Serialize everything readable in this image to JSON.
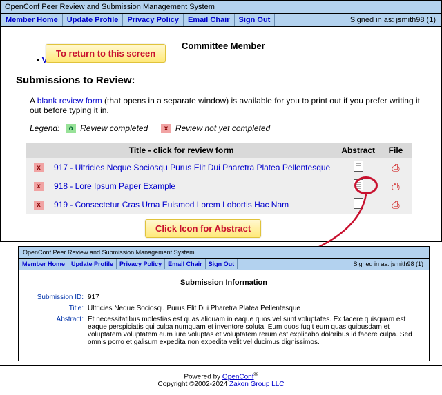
{
  "app": {
    "title": "OpenConf Peer Review and Submission Management System",
    "signed_in": "Signed in as: jsmith98 (1)"
  },
  "nav": {
    "member_home": "Member Home",
    "update_profile": "Update Profile",
    "privacy_policy": "Privacy Policy",
    "email_chair": "Email Chair",
    "sign_out": "Sign Out"
  },
  "callouts": {
    "return_screen": "To return to this screen",
    "click_abstract": "Click Icon for Abstract"
  },
  "main": {
    "role": "Committee Member",
    "view_submissions": "View Submissions",
    "heading": "Submissions to Review:",
    "blurb_pre": "A ",
    "blurb_link": "blank review form",
    "blurb_post": " (that opens in a separate window) is available for you to print out if you prefer writing it out before typing it in.",
    "legend_label": "Legend:",
    "legend_complete": "Review completed",
    "legend_incomplete": "Review not yet completed"
  },
  "table": {
    "header_title": "Title - click for review form",
    "header_abstract": "Abstract",
    "header_file": "File",
    "rows": [
      {
        "status": "x",
        "link": "917 - Ultricies Neque Sociosqu Purus Elit Dui Pharetra Platea Pellentesque"
      },
      {
        "status": "x",
        "link": "918 - Lore Ipsum Paper Example"
      },
      {
        "status": "x",
        "link": "919 - Consectetur Cras Urna Euismod Lorem Lobortis Hac Nam"
      }
    ]
  },
  "powered": {
    "pre": "Powered by ",
    "name": "OpenConf",
    "sup": "®"
  },
  "subinfo": {
    "heading": "Submission Information",
    "id_label": "Submission ID:",
    "id_val": "917",
    "title_label": "Title:",
    "title_val": "Ultricies Neque Sociosqu Purus Elit Dui Pharetra Platea Pellentesque",
    "abstract_label": "Abstract:",
    "abstract_val": "Et necessitatibus molestias est quas aliquam in eaque quos vel sunt voluptates. Ex facere quisquam est eaque perspiciatis qui culpa numquam et inventore soluta. Eum quos fugit eum quas quibusdam et voluptatem voluptatem eum iure voluptas et voluptatem rerum est explicabo doloribus id facere culpa. Sed omnis porro et galisum expedita non expedita velit vel ducimus dignissimos."
  },
  "footer": {
    "powered_pre": "Powered by ",
    "powered_name": "OpenConf",
    "sup": "®",
    "copyright": "Copyright ©2002-2024 ",
    "copyright_link": "Zakon Group LLC"
  }
}
